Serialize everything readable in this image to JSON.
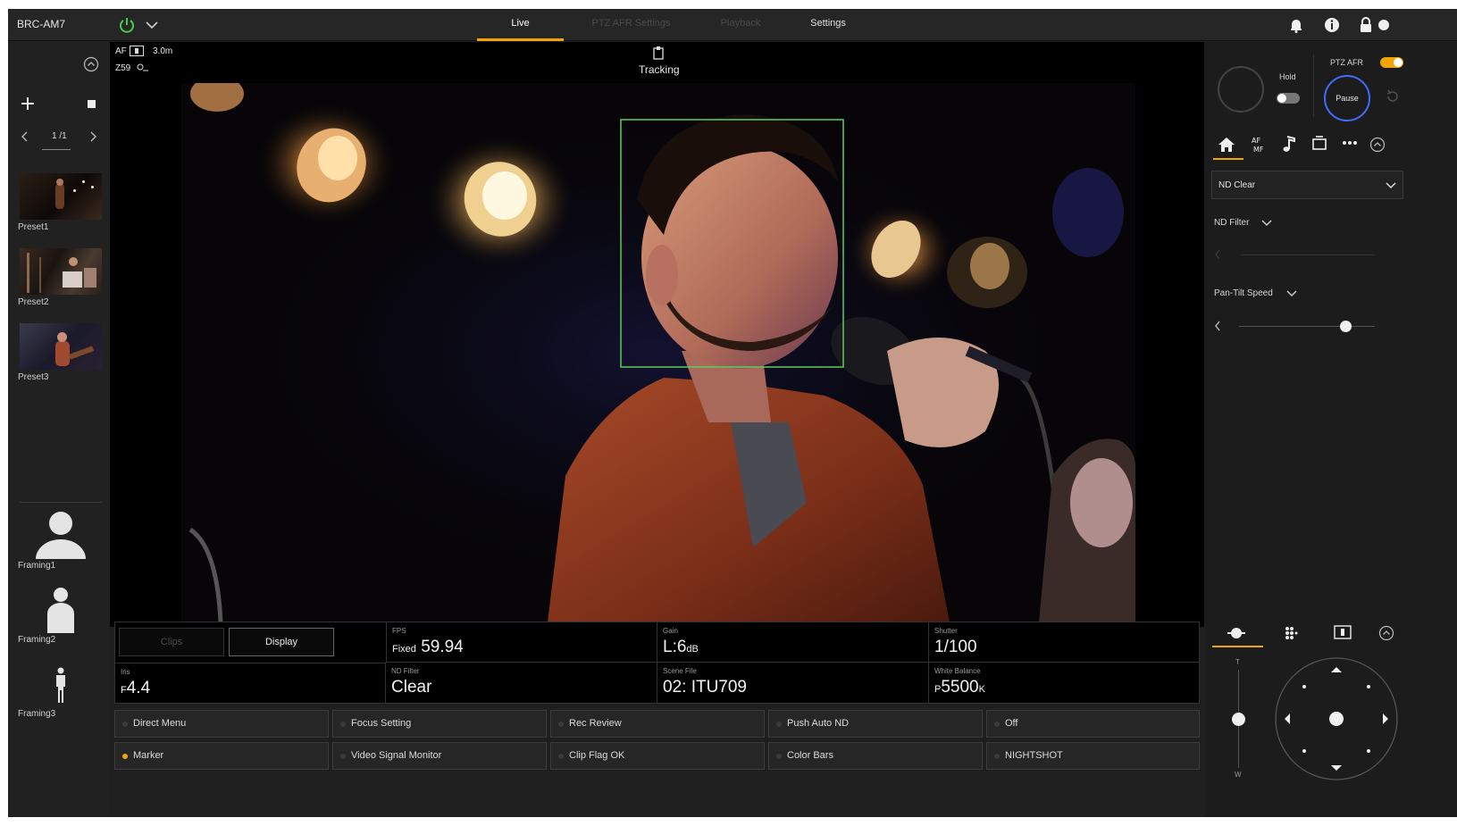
{
  "header": {
    "model": "BRC-AM7",
    "tabs": [
      {
        "label": "Live",
        "state": "active"
      },
      {
        "label": "PTZ AFR Settings",
        "state": "disabled"
      },
      {
        "label": "Playback",
        "state": "disabled"
      },
      {
        "label": "Settings",
        "state": "normal"
      }
    ],
    "icons": [
      "power-icon",
      "chevron-down-icon",
      "bell-icon",
      "info-icon",
      "lock-icon",
      "toggle-icon"
    ]
  },
  "left_panel": {
    "page_indicator": "1 /1",
    "presets": [
      "Preset1",
      "Preset2",
      "Preset3"
    ],
    "framings": [
      "Framing1",
      "Framing2",
      "Framing3"
    ]
  },
  "viewer": {
    "af_label": "AF",
    "focus_distance": "3.0m",
    "zoom": "Z59",
    "tracking_label": "Tracking"
  },
  "status": {
    "left_buttons": {
      "clips": "Clips",
      "display": "Display"
    },
    "fps": {
      "label": "FPS",
      "prefix": "Fixed",
      "value": "59.94"
    },
    "gain": {
      "label": "Gain",
      "value": "L:6",
      "unit": "dB"
    },
    "shutter": {
      "label": "Shutter",
      "value": "1/100"
    },
    "iris": {
      "label": "Iris",
      "prefix": "F",
      "value": "4.4"
    },
    "nd": {
      "label": "ND Filter",
      "value": "Clear"
    },
    "scene": {
      "label": "Scene File",
      "value": "02: ITU709"
    },
    "wb": {
      "label": "White Balance",
      "prefix": "P",
      "value": "5500",
      "unit": "K"
    }
  },
  "assign_buttons": [
    {
      "label": "Direct Menu",
      "active": false
    },
    {
      "label": "Focus Setting",
      "active": false
    },
    {
      "label": "Rec Review",
      "active": false
    },
    {
      "label": "Push Auto ND",
      "active": false
    },
    {
      "label": "Off",
      "active": false
    },
    {
      "label": "Marker",
      "active": true
    },
    {
      "label": "Video Signal Monitor",
      "active": false
    },
    {
      "label": "Clip Flag OK",
      "active": false
    },
    {
      "label": "Color Bars",
      "active": false
    },
    {
      "label": "NIGHTSHOT",
      "active": false
    }
  ],
  "right_panel": {
    "hold_label": "Hold",
    "ptz_afr_label": "PTZ AFR",
    "pause_label": "Pause",
    "nd_dropdown": "ND Clear",
    "nd_filter_label": "ND Filter",
    "pan_tilt_speed_label": "Pan-Tilt Speed",
    "pan_tilt_speed_level": 0.78,
    "zoom_slider_top": "T",
    "zoom_slider_bottom": "W"
  },
  "colors": {
    "accent": "#f0a500",
    "face_box": "#5ecb5e",
    "pause_ring": "#3f6cff"
  }
}
